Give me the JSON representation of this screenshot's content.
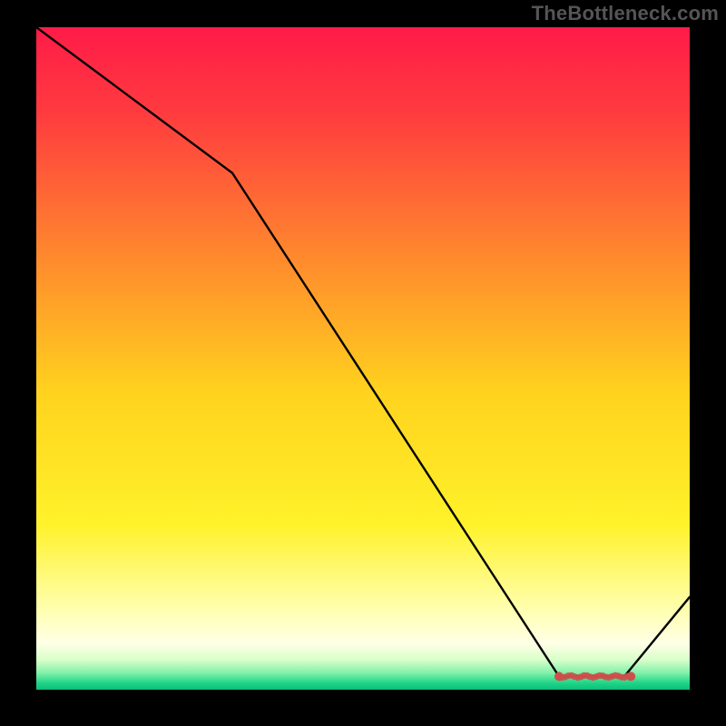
{
  "watermark": "TheBottleneck.com",
  "chart_data": {
    "type": "line",
    "title": "",
    "xlabel": "",
    "ylabel": "",
    "xlim": [
      0,
      100
    ],
    "ylim": [
      0,
      100
    ],
    "grid": false,
    "legend": null,
    "series": [
      {
        "name": "curve",
        "x": [
          0,
          30,
          80,
          90,
          100
        ],
        "y": [
          100,
          78,
          2,
          2,
          14
        ]
      }
    ],
    "markers": {
      "name": "highlight-band",
      "x_center": 85,
      "x_range": [
        80,
        91
      ],
      "y": 2,
      "color": "#cd4f4b"
    },
    "background_gradient": {
      "stops": [
        {
          "pos": 0.0,
          "color": "#ff1b48"
        },
        {
          "pos": 0.13,
          "color": "#ff3b3f"
        },
        {
          "pos": 0.35,
          "color": "#ff8a2d"
        },
        {
          "pos": 0.55,
          "color": "#ffd21e"
        },
        {
          "pos": 0.75,
          "color": "#fff22a"
        },
        {
          "pos": 0.88,
          "color": "#ffffb0"
        },
        {
          "pos": 0.93,
          "color": "#ffffe6"
        },
        {
          "pos": 0.955,
          "color": "#d8ffca"
        },
        {
          "pos": 0.975,
          "color": "#7ff0a8"
        },
        {
          "pos": 0.99,
          "color": "#1fd488"
        },
        {
          "pos": 1.0,
          "color": "#0abf78"
        }
      ]
    }
  }
}
